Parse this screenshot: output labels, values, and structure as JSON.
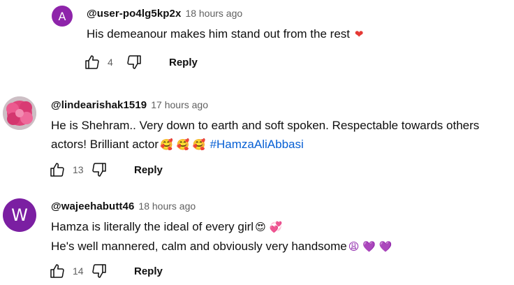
{
  "comments": [
    {
      "author": "@user-po4lg5kp2x",
      "time": "18 hours ago",
      "avatar_letter": "A",
      "avatar_color": "#8e24aa",
      "text_line1": "His demeanour makes him stand out from the rest",
      "emoji_line1": "❤",
      "likes": "4",
      "reply_label": "Reply"
    },
    {
      "author": "@lindearishak1519",
      "time": "17 hours ago",
      "avatar_icon": "pink-flower-icon",
      "text_line1": "He is Shehram.. Very down to earth and soft spoken. Respectable towards others",
      "text_line2": "actors! Brilliant actor",
      "emoji_line2": "🥰 🥰 🥰",
      "hashtag": "#HamzaAliAbbasi",
      "likes": "13",
      "reply_label": "Reply"
    },
    {
      "author": "@wajeehabutt46",
      "time": "18 hours ago",
      "avatar_letter": "W",
      "avatar_color": "#7b1fa2",
      "text_line1": "Hamza is literally the ideal of every girl",
      "emoji_line1": "😍 💞",
      "text_line2": "He's well mannered, calm and obviously very handsome",
      "emoji_line2": "😩 💜 💜",
      "likes": "14",
      "reply_label": "Reply"
    }
  ],
  "colors": {
    "hashtag": "#065fd4",
    "secondary_text": "#606060",
    "heart": "#e53935",
    "purple_heart": "#8e24aa"
  }
}
